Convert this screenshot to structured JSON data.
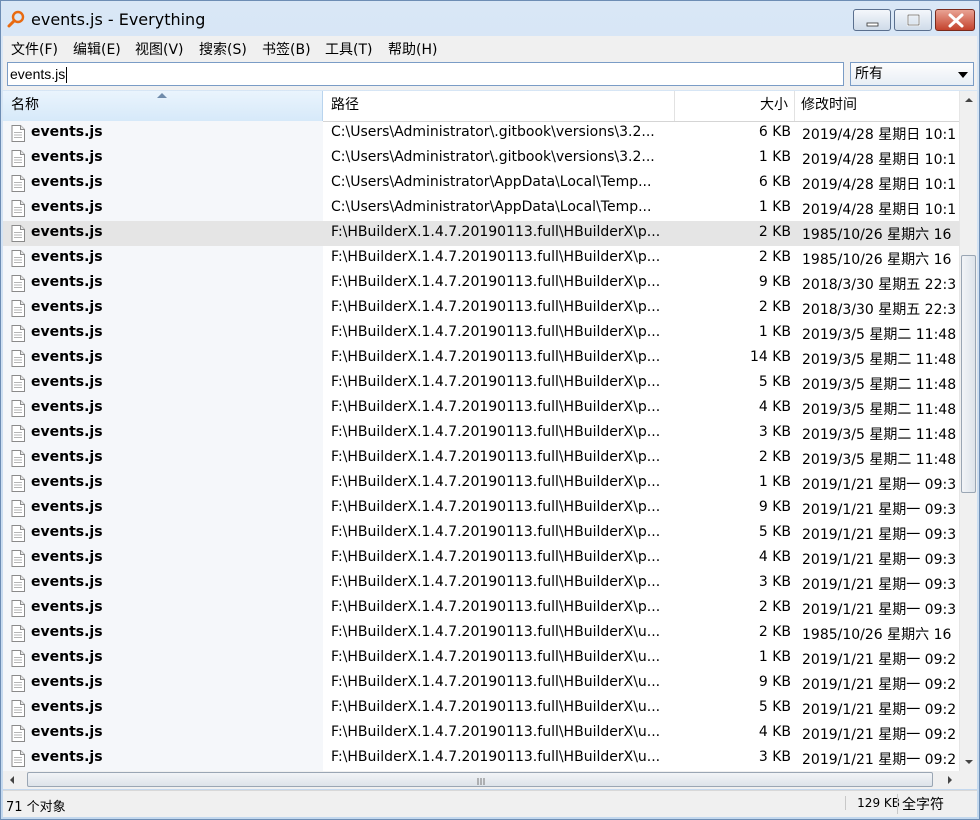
{
  "window": {
    "title": "events.js - Everything"
  },
  "menu": [
    "文件(F)",
    "编辑(E)",
    "视图(V)",
    "搜索(S)",
    "书签(B)",
    "工具(T)",
    "帮助(H)"
  ],
  "search": {
    "value": "events.js",
    "filter": "所有"
  },
  "columns": {
    "name": "名称",
    "path": "路径",
    "size": "大小",
    "modified": "修改时间"
  },
  "rows": [
    {
      "name": "events.js",
      "path": "C:\\Users\\Administrator\\.gitbook\\versions\\3.2...",
      "size": "6 KB",
      "modified": "2019/4/28 星期日 10:1"
    },
    {
      "name": "events.js",
      "path": "C:\\Users\\Administrator\\.gitbook\\versions\\3.2...",
      "size": "1 KB",
      "modified": "2019/4/28 星期日 10:1"
    },
    {
      "name": "events.js",
      "path": "C:\\Users\\Administrator\\AppData\\Local\\Temp...",
      "size": "6 KB",
      "modified": "2019/4/28 星期日 10:1"
    },
    {
      "name": "events.js",
      "path": "C:\\Users\\Administrator\\AppData\\Local\\Temp...",
      "size": "1 KB",
      "modified": "2019/4/28 星期日 10:1"
    },
    {
      "name": "events.js",
      "path": "F:\\HBuilderX.1.4.7.20190113.full\\HBuilderX\\p...",
      "size": "2 KB",
      "modified": "1985/10/26 星期六 16"
    },
    {
      "name": "events.js",
      "path": "F:\\HBuilderX.1.4.7.20190113.full\\HBuilderX\\p...",
      "size": "2 KB",
      "modified": "1985/10/26 星期六 16"
    },
    {
      "name": "events.js",
      "path": "F:\\HBuilderX.1.4.7.20190113.full\\HBuilderX\\p...",
      "size": "9 KB",
      "modified": "2018/3/30 星期五 22:3"
    },
    {
      "name": "events.js",
      "path": "F:\\HBuilderX.1.4.7.20190113.full\\HBuilderX\\p...",
      "size": "2 KB",
      "modified": "2018/3/30 星期五 22:3"
    },
    {
      "name": "events.js",
      "path": "F:\\HBuilderX.1.4.7.20190113.full\\HBuilderX\\p...",
      "size": "1 KB",
      "modified": "2019/3/5 星期二 11:48"
    },
    {
      "name": "events.js",
      "path": "F:\\HBuilderX.1.4.7.20190113.full\\HBuilderX\\p...",
      "size": "14 KB",
      "modified": "2019/3/5 星期二 11:48"
    },
    {
      "name": "events.js",
      "path": "F:\\HBuilderX.1.4.7.20190113.full\\HBuilderX\\p...",
      "size": "5 KB",
      "modified": "2019/3/5 星期二 11:48"
    },
    {
      "name": "events.js",
      "path": "F:\\HBuilderX.1.4.7.20190113.full\\HBuilderX\\p...",
      "size": "4 KB",
      "modified": "2019/3/5 星期二 11:48"
    },
    {
      "name": "events.js",
      "path": "F:\\HBuilderX.1.4.7.20190113.full\\HBuilderX\\p...",
      "size": "3 KB",
      "modified": "2019/3/5 星期二 11:48"
    },
    {
      "name": "events.js",
      "path": "F:\\HBuilderX.1.4.7.20190113.full\\HBuilderX\\p...",
      "size": "2 KB",
      "modified": "2019/3/5 星期二 11:48"
    },
    {
      "name": "events.js",
      "path": "F:\\HBuilderX.1.4.7.20190113.full\\HBuilderX\\p...",
      "size": "1 KB",
      "modified": "2019/1/21 星期一 09:3"
    },
    {
      "name": "events.js",
      "path": "F:\\HBuilderX.1.4.7.20190113.full\\HBuilderX\\p...",
      "size": "9 KB",
      "modified": "2019/1/21 星期一 09:3"
    },
    {
      "name": "events.js",
      "path": "F:\\HBuilderX.1.4.7.20190113.full\\HBuilderX\\p...",
      "size": "5 KB",
      "modified": "2019/1/21 星期一 09:3"
    },
    {
      "name": "events.js",
      "path": "F:\\HBuilderX.1.4.7.20190113.full\\HBuilderX\\p...",
      "size": "4 KB",
      "modified": "2019/1/21 星期一 09:3"
    },
    {
      "name": "events.js",
      "path": "F:\\HBuilderX.1.4.7.20190113.full\\HBuilderX\\p...",
      "size": "3 KB",
      "modified": "2019/1/21 星期一 09:3"
    },
    {
      "name": "events.js",
      "path": "F:\\HBuilderX.1.4.7.20190113.full\\HBuilderX\\p...",
      "size": "2 KB",
      "modified": "2019/1/21 星期一 09:3"
    },
    {
      "name": "events.js",
      "path": "F:\\HBuilderX.1.4.7.20190113.full\\HBuilderX\\u...",
      "size": "2 KB",
      "modified": "1985/10/26 星期六 16"
    },
    {
      "name": "events.js",
      "path": "F:\\HBuilderX.1.4.7.20190113.full\\HBuilderX\\u...",
      "size": "1 KB",
      "modified": "2019/1/21 星期一 09:2"
    },
    {
      "name": "events.js",
      "path": "F:\\HBuilderX.1.4.7.20190113.full\\HBuilderX\\u...",
      "size": "9 KB",
      "modified": "2019/1/21 星期一 09:2"
    },
    {
      "name": "events.js",
      "path": "F:\\HBuilderX.1.4.7.20190113.full\\HBuilderX\\u...",
      "size": "5 KB",
      "modified": "2019/1/21 星期一 09:2"
    },
    {
      "name": "events.js",
      "path": "F:\\HBuilderX.1.4.7.20190113.full\\HBuilderX\\u...",
      "size": "4 KB",
      "modified": "2019/1/21 星期一 09:2"
    },
    {
      "name": "events.js",
      "path": "F:\\HBuilderX.1.4.7.20190113.full\\HBuilderX\\u...",
      "size": "3 KB",
      "modified": "2019/1/21 星期一 09:2"
    }
  ],
  "selected_row": 4,
  "scroll": {
    "vertical_position": 0.36,
    "vertical_visible_fraction": 0.37
  },
  "status": {
    "count": "71 个对象",
    "size": "129 KB",
    "mode": "全字符"
  },
  "icons": {
    "app": "magnifier-icon",
    "file": "file-icon"
  }
}
